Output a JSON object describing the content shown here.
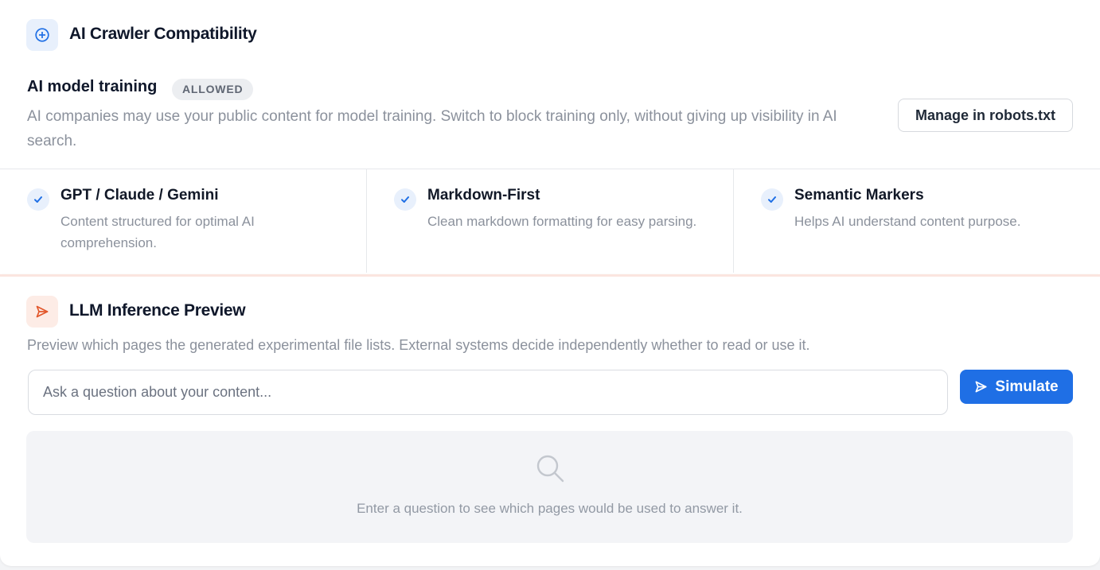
{
  "crawler": {
    "title": "AI Crawler Compatibility",
    "icon": "plus-circle-icon",
    "training": {
      "title": "AI model training",
      "badge": "ALLOWED",
      "description": "AI companies may use your public content for model training. Switch to block training only, without giving up visibility in AI search.",
      "button_label": "Manage in robots.txt"
    },
    "features": [
      {
        "title": "GPT / Claude / Gemini",
        "description": "Content structured for optimal AI comprehension.",
        "icon": "check-icon"
      },
      {
        "title": "Markdown-First",
        "description": "Clean markdown formatting for easy parsing.",
        "icon": "check-icon"
      },
      {
        "title": "Semantic Markers",
        "description": "Helps AI understand content purpose.",
        "icon": "check-icon"
      }
    ]
  },
  "inference": {
    "title": "LLM Inference Preview",
    "icon": "send-icon",
    "description": "Preview which pages the generated experimental file lists. External systems decide independently whether to read or use it.",
    "input_placeholder": "Ask a question about your content...",
    "input_value": "",
    "simulate_label": "Simulate",
    "empty_state_icon": "search-icon",
    "empty_state_text": "Enter a question to see which pages would be used to answer it."
  },
  "colors": {
    "accent_blue": "#1f6fe5",
    "accent_orange": "#e2572b",
    "badge_bg": "#eceef1",
    "divider_orange": "#fbe5df"
  }
}
